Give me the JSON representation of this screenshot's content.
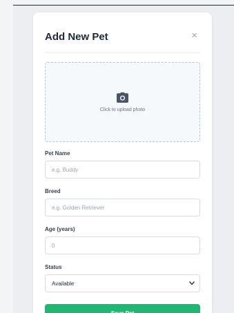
{
  "modal": {
    "title": "Add New Pet",
    "close_symbol": "×"
  },
  "upload": {
    "icon": "camera-icon",
    "label": "Click to upload photo"
  },
  "form": {
    "pet_name": {
      "label": "Pet Name",
      "placeholder": "e.g. Buddy",
      "value": ""
    },
    "breed": {
      "label": "Breed",
      "placeholder": "e.g. Golden Retriever",
      "value": ""
    },
    "age": {
      "label": "Age (years)",
      "placeholder": "0",
      "value": ""
    },
    "status": {
      "label": "Status",
      "selected": "Available"
    }
  },
  "actions": {
    "save_label": "Save Pet"
  },
  "colors": {
    "accent": "#22b573",
    "title": "#1f2937",
    "upload_bg": "#f5f9fb"
  }
}
